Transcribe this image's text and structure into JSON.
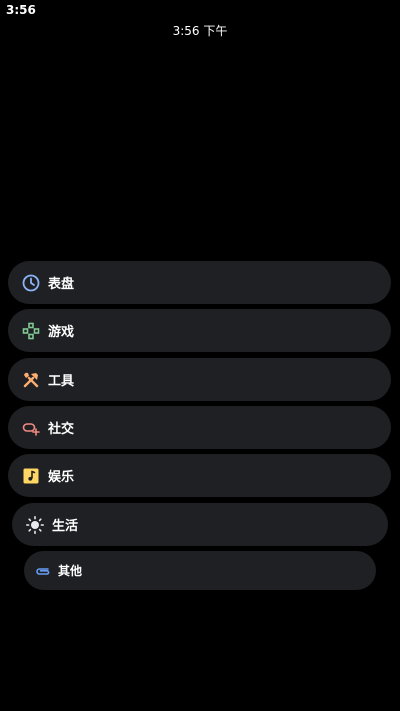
{
  "status_bar": {
    "time": "3:56"
  },
  "watch_face": {
    "time": "3:56 下午"
  },
  "menu": {
    "items": [
      {
        "label": "表盘",
        "icon": "clock-icon",
        "color": "#8ab4f8"
      },
      {
        "label": "游戏",
        "icon": "gamepad-icon",
        "color": "#81c995"
      },
      {
        "label": "工具",
        "icon": "tools-icon",
        "color": "#fcad70"
      },
      {
        "label": "社交",
        "icon": "social-icon",
        "color": "#f28b82"
      },
      {
        "label": "娱乐",
        "icon": "music-icon",
        "color": "#fdd663"
      },
      {
        "label": "生活",
        "icon": "sun-icon",
        "color": "#e8eaed"
      },
      {
        "label": "其他",
        "icon": "clip-icon",
        "color": "#669df6"
      }
    ]
  },
  "colors": {
    "background": "#000000",
    "item_background": "#1f2023",
    "text": "#ffffff"
  }
}
